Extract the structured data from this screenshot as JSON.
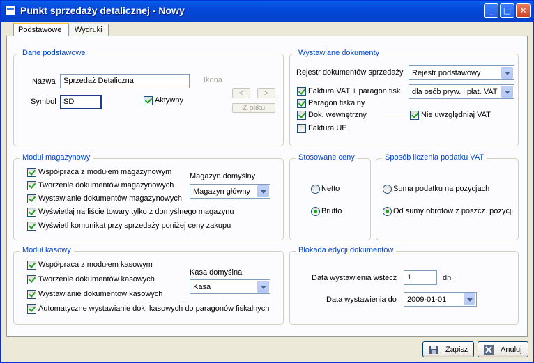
{
  "window": {
    "title": "Punkt sprzedaży detalicznej - Nowy"
  },
  "tabs": [
    "Podstawowe",
    "Wydruki"
  ],
  "dane_podstawowe": {
    "legend": "Dane podstawowe",
    "nazwa_label": "Nazwa",
    "nazwa_value": "Sprzedaż Detaliczna",
    "symbol_label": "Symbol",
    "symbol_value": "SD",
    "aktywny_label": "Aktywny",
    "ikona_label": "Ikona",
    "prev_label": "<",
    "next_label": ">",
    "z_pliku_label": "Z pliku"
  },
  "wystawiane_dokumenty": {
    "legend": "Wystawiane dokumenty",
    "rejestr_label": "Rejestr dokumentów sprzedaży",
    "rejestr_value": "Rejestr podstawowy",
    "faktura_vat_label": "Faktura VAT + paragon fisk.",
    "faktura_vat_option": "dla osób pryw. i płat. VAT",
    "paragon_label": "Paragon fiskalny",
    "dok_wew_label": "Dok. wewnętrzny",
    "nie_uwzgledniaj_label": "Nie uwzględniaj VAT",
    "faktura_ue_label": "Faktura UE"
  },
  "modul_magazynowy": {
    "legend": "Moduł magazynowy",
    "items": [
      "Współpraca z modułem magazynowym",
      "Tworzenie dokumentów magazynowych",
      "Wystawianie dokumentów magazynowych",
      "Wyświetlaj na liście towary tylko z domyślnego magazynu",
      "Wyświetl komunikat przy sprzedaży poniżej ceny zakupu"
    ],
    "magazyn_label": "Magazyn domyślny",
    "magazyn_value": "Magazyn główny"
  },
  "stosowane_ceny": {
    "legend": "Stosowane ceny",
    "netto_label": "Netto",
    "brutto_label": "Brutto",
    "selected": "Brutto"
  },
  "sposob_vat": {
    "legend": "Sposób liczenia podatku VAT",
    "opt1_label": "Suma podatku na pozycjach",
    "opt2_label": "Od sumy obrotów z poszcz. pozycji",
    "selected": "Od sumy obrotów z poszcz. pozycji"
  },
  "modul_kasowy": {
    "legend": "Moduł kasowy",
    "items": [
      "Współpraca z modułem kasowym",
      "Tworzenie dokumentów kasowych",
      "Wystawianie dokumentów kasowych",
      "Automatyczne wystawianie dok. kasowych do paragonów fiskalnych"
    ],
    "kasa_label": "Kasa domyślna",
    "kasa_value": "Kasa"
  },
  "blokada": {
    "legend": "Blokada edycji dokumentów",
    "wstecz_label": "Data wystawienia wstecz",
    "wstecz_value": "1",
    "dni_label": "dni",
    "do_label": "Data wystawienia do",
    "do_value": "2009-01-01"
  },
  "footer": {
    "zapisz_label": "Zapisz",
    "anuluj_label": "Anuluj"
  },
  "colors": {
    "title_bar": "#0448D8",
    "legend_text": "#0046D5",
    "check_green": "#21A121",
    "window_bg": "#ECE9D8"
  }
}
